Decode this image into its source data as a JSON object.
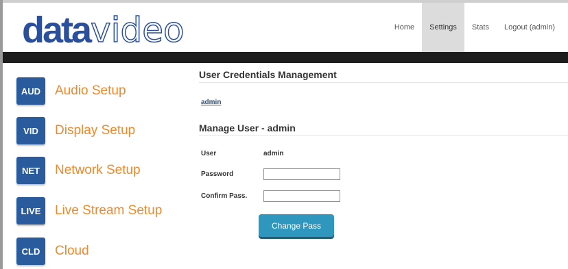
{
  "logo": {
    "part1": "data",
    "part2": "video"
  },
  "nav": {
    "home": "Home",
    "settings": "Settings",
    "stats": "Stats",
    "logout": "Logout (admin)"
  },
  "sidebar": {
    "items": [
      {
        "badge": "AUD",
        "label": "Audio Setup"
      },
      {
        "badge": "VID",
        "label": "Display Setup"
      },
      {
        "badge": "NET",
        "label": "Network Setup"
      },
      {
        "badge": "LIVE",
        "label": "Live Stream Setup"
      },
      {
        "badge": "CLD",
        "label": "Cloud"
      }
    ]
  },
  "main": {
    "section_title": "User Credentials Management",
    "user_link": "admin",
    "manage_title": "Manage User - admin",
    "form": {
      "user_label": "User",
      "user_value": "admin",
      "password_label": "Password",
      "password_value": "",
      "confirm_label": "Confirm Pass.",
      "confirm_value": ""
    },
    "change_button": "Change Pass"
  },
  "colors": {
    "brand_blue": "#2a4f9c",
    "accent_orange": "#f0892a",
    "badge_blue": "#2a5b9c",
    "button_teal": "#2f97bd"
  }
}
